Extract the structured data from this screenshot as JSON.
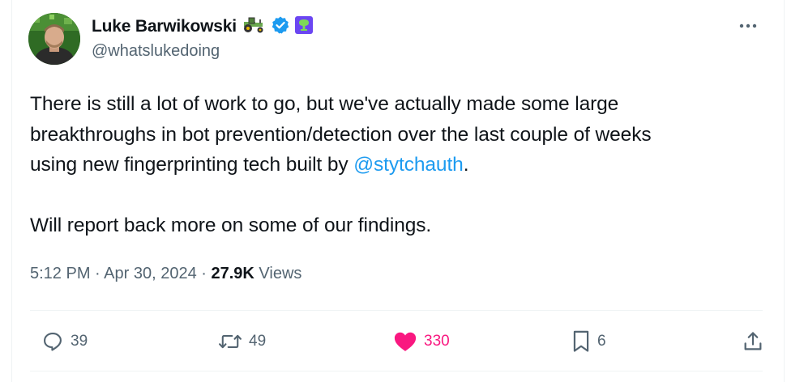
{
  "author": {
    "display_name": "Luke Barwikowski",
    "handle": "@whatslukedoing",
    "emoji_icon": "tractor-icon",
    "verified_icon": "verified-badge-icon",
    "affiliate_icon": "affiliate-badge-icon"
  },
  "tweet": {
    "text_line1_part1": "There is still a lot of work to go, but we've actually made some large",
    "text_line2": "breakthroughs in bot prevention/detection over the last couple of weeks",
    "text_line3_before": "using new fingerprinting tech built by ",
    "mention": "@stytchauth",
    "text_line3_after": ".",
    "text_para2": "Will report back more on some of our findings."
  },
  "meta": {
    "time": "5:12 PM",
    "sep1": " · ",
    "date": "Apr 30, 2024",
    "sep2": " · ",
    "views_count": "27.9K",
    "views_label": " Views"
  },
  "actions": {
    "replies": "39",
    "reposts": "49",
    "likes": "330",
    "bookmarks": "6"
  },
  "colors": {
    "text": "#0f1419",
    "secondary": "#536471",
    "link": "#1d9bf0",
    "like": "#f91880",
    "verified": "#1d9bf0",
    "affiliate": "#6b46f2"
  }
}
